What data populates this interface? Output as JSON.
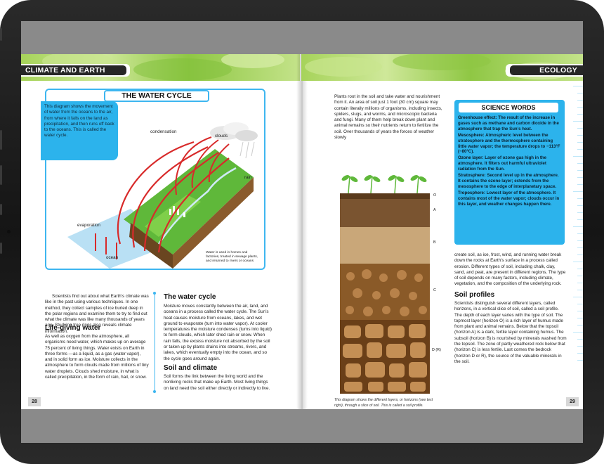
{
  "left_page": {
    "header": "CLIMATE AND EARTH",
    "page_number": "28",
    "water_cycle": {
      "title": "THE WATER CYCLE",
      "intro": "This diagram shows the movement of water from the oceans to the air, from where it falls on the land as precipitation, and then runs off back to the oceans. This is called the water cycle.",
      "labels": {
        "condensation": "condensation",
        "clouds": "clouds",
        "rain": "rain",
        "evaporation": "evaporation",
        "ocean": "ocean",
        "note": "Water is used in homes and factories, treated in sewage plants, and returned to rivers or oceans"
      }
    },
    "col1": {
      "intro": "Scientists find out about what Earth’s climate was like in the past using various techniques. In one method, they collect samples of ice buried deep in the polar regions and examine them to try to find out what the climate was like many thousands of years ago. Studying tree rings also reveals climate information.",
      "heading": "Life-giving water",
      "body": "As well as oxygen from the atmosphere, all organisms need water, which makes up on average 75 percent of living things. Water exists on Earth in three forms —as a liquid, as a gas (water vapor), and in solid form as ice. Moisture collects in the atmosphere to form clouds made from millions of tiny water droplets. Clouds shed moisture, in what is called precipitation, in the form of rain, hail, or snow."
    },
    "col2": {
      "heading1": "The water cycle",
      "body1": "Moisture moves constantly between the air, land, and oceans in a process called the water cycle. The Sun’s heat causes moisture from oceans, lakes, and wet ground to evaporate (turn into water vapor). At cooler temperatures the moisture condenses (turns into liquid) to form clouds, which later shed rain or snow. When rain falls, the excess moisture not absorbed by the soil or taken up by plants drains into streams, rivers, and lakes, which eventually empty into the ocean, and so the cycle goes around again.",
      "heading2": "Soil and climate",
      "body2": "Soil forms the link between the living world and the nonliving rocks that make up Earth. Most living things on land need the soil either directly or indirectly to live."
    }
  },
  "right_page": {
    "header": "ECOLOGY",
    "page_number": "29",
    "col1_top": "Plants root in the soil and take water and nourishment from it. An area of soil just 1 foot (30 cm) square may contain literally millions of organisms, including insects, spiders, slugs, and worms, and microscopic bacteria and fungi. Many of them help break down plant and animal remains so their nutrients return to fertilize the soil. Over thousands of years the forces of weather slowly",
    "soil_layers": [
      "O",
      "A",
      "B",
      "C",
      "D (R)"
    ],
    "caption": "This diagram shows the different layers, or horizons (see text right), through a slice of soil. This is called a soil profile.",
    "col2_top": "create soil, as ice, frost, wind, and running water break down the rocks at Earth’s surface in a process called erosion. Different types of soil, including chalk, clay, sand, and peat, are present in different regions. The type of soil depends on many factors, including climate, vegetation, and the composition of the underlying rock.",
    "soil_profiles": {
      "heading": "Soil profiles",
      "body": "Scientists distinguish several different layers, called horizons, in a vertical slice of soil, called a soil profile. The depth of each layer varies with the type of soil. The topmost layer (horizon O) is a rich layer of humus made from plant and animal remains. Below that the topsoil (horizon A) is a dark, fertile layer containing humus. The subsoil (horizon B) is nourished by minerals washed from the topsoil. The zone of partly weathered rock below that (horizon C) is less fertile. Last comes the bedrock (horizon D or R), the source of the valuable minerals in the soil."
    },
    "science_words": {
      "title": "SCIENCE WORDS",
      "items": [
        {
          "term": "Greenhouse effect:",
          "def": "The result of the increase in gases such as methane and carbon dioxide in the atmosphere that trap the Sun’s heat."
        },
        {
          "term": "Mesosphere:",
          "def": "Atmospheric level between the stratosphere and the thermosphere containing little water vapor; the temperature drops to −113°F (−80°C)."
        },
        {
          "term": "Ozone layer:",
          "def": "Layer of ozone gas high in the atmosphere. It filters out harmful ultraviolet radiation from the Sun."
        },
        {
          "term": "Stratosphere:",
          "def": "Second level up in the atmosphere. It contains the ozone layer; extends from the mesosphere to the edge of interplanetary space."
        },
        {
          "term": "Troposphere:",
          "def": "Lowest layer of the atmosphere. It contains most of the water vapor; clouds occur in this layer, and weather changes happen there."
        }
      ]
    }
  },
  "colors": {
    "accent_blue": "#2cb3ec",
    "banner_green": "#9ccf4e",
    "header_dark": "#262626"
  }
}
